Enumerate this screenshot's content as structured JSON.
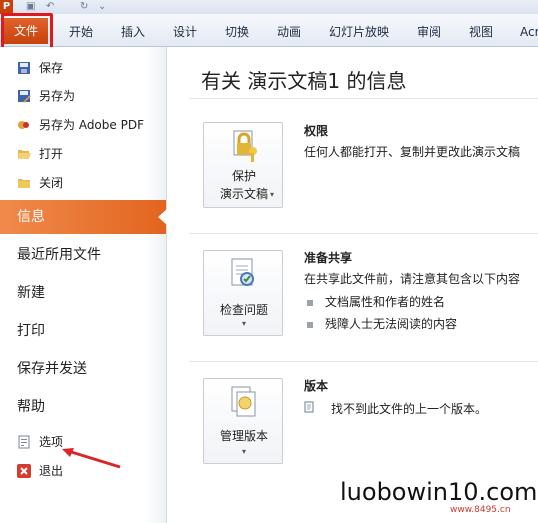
{
  "quick_access": {
    "app_logo": "P"
  },
  "ribbon": {
    "file_tab": "文件",
    "tabs": [
      "开始",
      "插入",
      "设计",
      "切换",
      "动画",
      "幻灯片放映",
      "审阅",
      "视图",
      "Acr"
    ]
  },
  "backstage_menu": {
    "small_items": [
      {
        "label": "保存",
        "icon": "save-icon"
      },
      {
        "label": "另存为",
        "icon": "save-as-icon"
      },
      {
        "label": "另存为 Adobe PDF",
        "icon": "adobe-pdf-icon"
      },
      {
        "label": "打开",
        "icon": "open-folder-icon"
      },
      {
        "label": "关闭",
        "icon": "close-folder-icon"
      }
    ],
    "big_items": [
      "信息",
      "最近所用文件",
      "新建",
      "打印",
      "保存并发送",
      "帮助"
    ],
    "selected": "信息",
    "options_label": "选项",
    "exit_label": "退出"
  },
  "info_page": {
    "title": "有关 演示文稿1 的信息",
    "permissions": {
      "button_line1": "保护",
      "button_line2": "演示文稿",
      "heading": "权限",
      "description": "任何人都能打开、复制并更改此演示文稿"
    },
    "prepare": {
      "button_label": "检查问题",
      "heading": "准备共享",
      "description": "在共享此文件前，请注意其包含以下内容",
      "bullets": [
        "文档属性和作者的姓名",
        "残障人士无法阅读的内容"
      ]
    },
    "versions": {
      "button_label": "管理版本",
      "heading": "版本",
      "description": "找不到此文件的上一个版本。"
    }
  },
  "watermark": {
    "text": "luobowin10.com",
    "subtext": "www.8495.cn"
  },
  "colors": {
    "accent": "#e2651f",
    "highlight_box": "#e0191f"
  }
}
